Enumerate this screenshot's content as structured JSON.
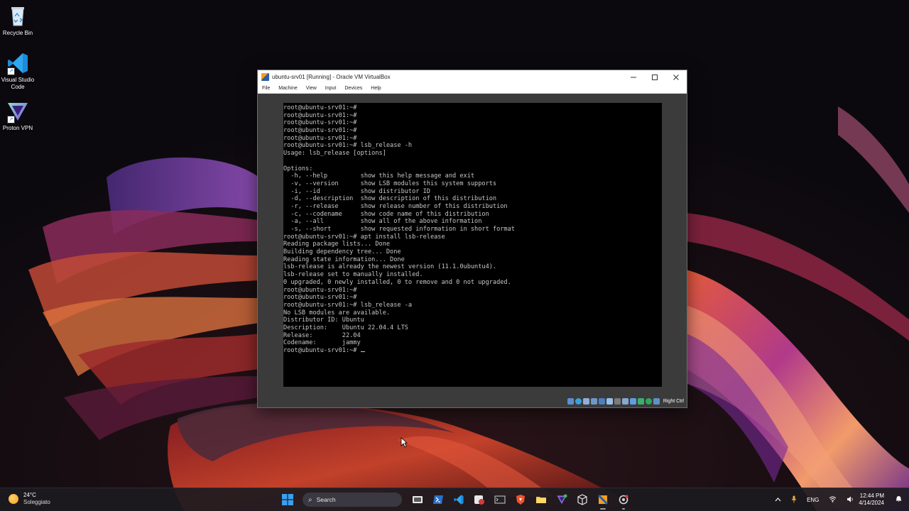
{
  "desktop": {
    "icons": [
      {
        "label": "Recycle Bin",
        "icon": "recycle-bin-icon"
      },
      {
        "label": "Visual Studio Code",
        "icon": "vscode-icon"
      },
      {
        "label": "Proton VPN",
        "icon": "proton-vpn-icon"
      }
    ]
  },
  "window": {
    "title": "ubuntu-srv01 [Running] - Oracle VM VirtualBox",
    "menu": [
      "File",
      "Machine",
      "View",
      "Input",
      "Devices",
      "Help"
    ],
    "host_key": "Right Ctrl"
  },
  "terminal": {
    "lines": [
      "root@ubuntu-srv01:~#",
      "root@ubuntu-srv01:~#",
      "root@ubuntu-srv01:~#",
      "root@ubuntu-srv01:~#",
      "root@ubuntu-srv01:~#",
      "root@ubuntu-srv01:~# lsb_release -h",
      "Usage: lsb_release [options]",
      "",
      "Options:",
      "  -h, --help         show this help message and exit",
      "  -v, --version      show LSB modules this system supports",
      "  -i, --id           show distributor ID",
      "  -d, --description  show description of this distribution",
      "  -r, --release      show release number of this distribution",
      "  -c, --codename     show code name of this distribution",
      "  -a, --all          show all of the above information",
      "  -s, --short        show requested information in short format",
      "root@ubuntu-srv01:~# apt install lsb-release",
      "Reading package lists... Done",
      "Building dependency tree... Done",
      "Reading state information... Done",
      "lsb-release is already the newest version (11.1.0ubuntu4).",
      "lsb-release set to manually installed.",
      "0 upgraded, 0 newly installed, 0 to remove and 0 not upgraded.",
      "root@ubuntu-srv01:~#",
      "root@ubuntu-srv01:~#",
      "root@ubuntu-srv01:~# lsb_release -a",
      "No LSB modules are available.",
      "Distributor ID: Ubuntu",
      "Description:    Ubuntu 22.04.4 LTS",
      "Release:        22.04",
      "Codename:       jammy",
      "root@ubuntu-srv01:~# "
    ]
  },
  "taskbar": {
    "weather_temp": "24°C",
    "weather_cond": "Soleggiato",
    "search_placeholder": "Search",
    "lang": "ENG",
    "time": "12:44 PM",
    "date": "4/14/2024"
  },
  "colors": {
    "terminal_bg": "#000000",
    "terminal_fg": "#c7c7c7",
    "vbox_frame": "#3a3b3a",
    "taskbar_bg": "#1c1a20"
  }
}
